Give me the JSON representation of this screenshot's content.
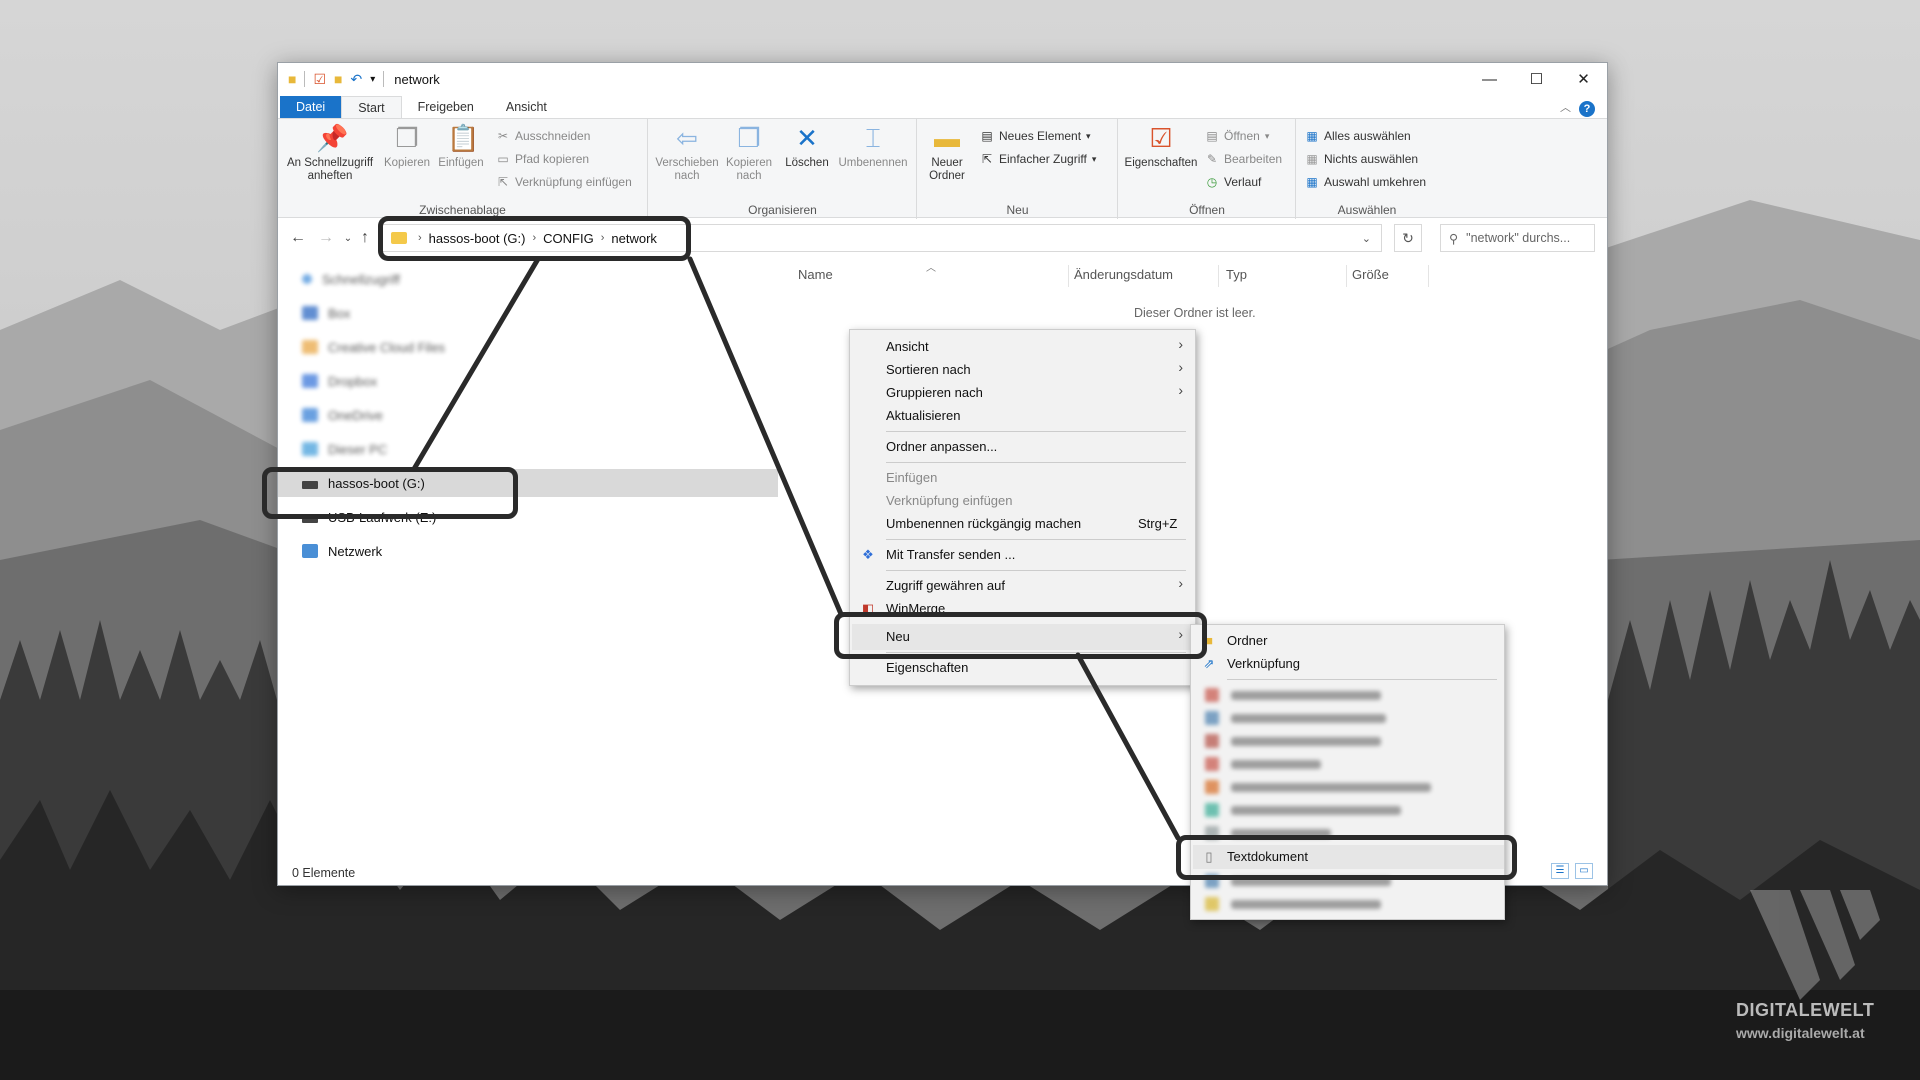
{
  "window": {
    "title": "network",
    "controls": {
      "minimize": "—",
      "maximize": "☐",
      "close": "✕"
    }
  },
  "ribbon_tabs": [
    "Datei",
    "Start",
    "Freigeben",
    "Ansicht"
  ],
  "ribbon": {
    "clipboard": {
      "pin": "An Schnellzugriff anheften",
      "copy": "Kopieren",
      "paste": "Einfügen",
      "cut": "Ausschneiden",
      "copy_path": "Pfad kopieren",
      "paste_shortcut": "Verknüpfung einfügen",
      "label": "Zwischenablage"
    },
    "organize": {
      "move_to": "Verschieben nach",
      "copy_to": "Kopieren nach",
      "delete": "Löschen",
      "rename": "Umbenennen",
      "label": "Organisieren"
    },
    "new": {
      "new_folder": "Neuer Ordner",
      "new_item": "Neues Element",
      "easy_access": "Einfacher Zugriff",
      "label": "Neu"
    },
    "open": {
      "properties": "Eigenschaften",
      "open": "Öffnen",
      "edit": "Bearbeiten",
      "history": "Verlauf",
      "label": "Öffnen"
    },
    "select": {
      "select_all": "Alles auswählen",
      "select_none": "Nichts auswählen",
      "invert": "Auswahl umkehren",
      "label": "Auswählen"
    }
  },
  "address": {
    "crumbs": [
      "hassos-boot (G:)",
      "CONFIG",
      "network"
    ],
    "search_placeholder": "\"network\" durchs..."
  },
  "sidebar": {
    "items": [
      {
        "label": "Schnellzugriff",
        "color": "#3b8ad9",
        "blurred": true
      },
      {
        "label": "Box",
        "color": "#1f5fbf",
        "blurred": true
      },
      {
        "label": "Creative Cloud Files",
        "color": "#e8a23a",
        "blurred": true
      },
      {
        "label": "Dropbox",
        "color": "#2f6fd8",
        "blurred": true
      },
      {
        "label": "OneDrive",
        "color": "#2b78d4",
        "blurred": true
      },
      {
        "label": "Dieser PC",
        "color": "#3a9ad9",
        "blurred": true
      },
      {
        "label": "hassos-boot (G:)",
        "blurred": false,
        "selected": true
      },
      {
        "label": "USB-Laufwerk (E:)",
        "blurred": false
      },
      {
        "label": "Netzwerk",
        "blurred": false
      }
    ]
  },
  "columns": [
    "Name",
    "Änderungsdatum",
    "Typ",
    "Größe"
  ],
  "empty_text": "Dieser Ordner ist leer.",
  "status_text": "0 Elemente",
  "context_menu": {
    "items": [
      {
        "label": "Ansicht",
        "submenu": true
      },
      {
        "label": "Sortieren nach",
        "submenu": true
      },
      {
        "label": "Gruppieren nach",
        "submenu": true
      },
      {
        "label": "Aktualisieren"
      },
      {
        "label": "Ordner anpassen..."
      },
      {
        "label": "Einfügen",
        "disabled": true
      },
      {
        "label": "Verknüpfung einfügen",
        "disabled": true
      },
      {
        "label": "Umbenennen rückgängig machen",
        "shortcut": "Strg+Z"
      },
      {
        "label": "Mit Transfer senden ..."
      },
      {
        "label": "Zugriff gewähren auf",
        "submenu": true
      },
      {
        "label": "WinMerge"
      },
      {
        "label": "Neu",
        "submenu": true
      },
      {
        "label": "Eigenschaften"
      }
    ]
  },
  "new_submenu": {
    "items": [
      {
        "label": "Ordner"
      },
      {
        "label": "Verknüpfung"
      },
      {
        "label": "Textdokument"
      }
    ],
    "blurred_colors": [
      "#c0392b",
      "#2e6da4",
      "#a93226",
      "#c0392b",
      "#d35400",
      "#16a085",
      "#7f8c8d",
      "#2e6da4",
      "#d4ac0d"
    ]
  },
  "watermark": {
    "brand": "DIGITALEWELT",
    "url": "www.digitalewelt.at"
  }
}
